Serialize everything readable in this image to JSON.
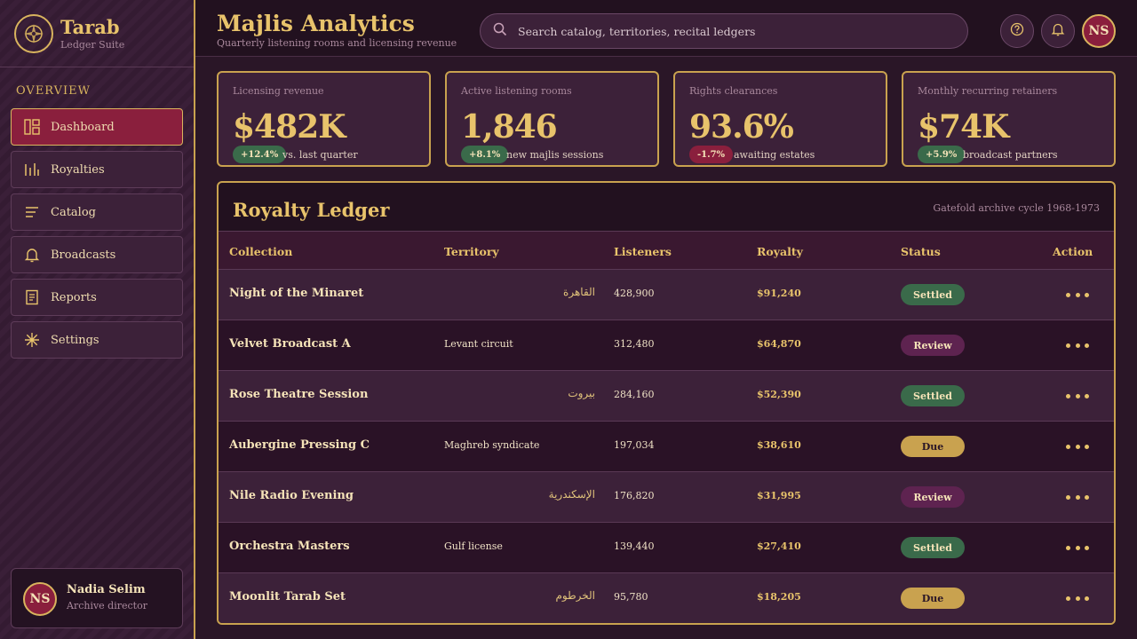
{
  "brand": {
    "name": "Tarab",
    "subtitle": "Ledger Suite"
  },
  "sidebar": {
    "heading": "OVERVIEW",
    "items": [
      {
        "label": "Dashboard",
        "icon": "dashboard-icon",
        "active": true
      },
      {
        "label": "Royalties",
        "icon": "bars-icon"
      },
      {
        "label": "Catalog",
        "icon": "list-icon"
      },
      {
        "label": "Broadcasts",
        "icon": "bell-icon"
      },
      {
        "label": "Reports",
        "icon": "document-icon"
      },
      {
        "label": "Settings",
        "icon": "sparkle-icon"
      }
    ]
  },
  "profile": {
    "initials": "NS",
    "name": "Nadia Selim",
    "role": "Archive director"
  },
  "header": {
    "title": "Majlis Analytics",
    "subtitle": "Quarterly listening rooms and licensing revenue",
    "search_placeholder": "Search catalog, territories, recital ledgers",
    "avatar_initials": "NS"
  },
  "kpis": [
    {
      "label": "Licensing revenue",
      "value": "$482K",
      "badge": "+12.4%",
      "trend": "up",
      "note": "vs. last quarter"
    },
    {
      "label": "Active listening rooms",
      "value": "1,846",
      "badge": "+8.1%",
      "trend": "up",
      "note": "new majlis sessions"
    },
    {
      "label": "Rights clearances",
      "value": "93.6%",
      "badge": "-1.7%",
      "trend": "down",
      "note": "awaiting estates"
    },
    {
      "label": "Monthly recurring retainers",
      "value": "$74K",
      "badge": "+5.9%",
      "trend": "up",
      "note": "broadcast partners"
    }
  ],
  "ledger": {
    "title": "Royalty Ledger",
    "cycle": "Gatefold archive cycle 1968-1973",
    "columns": {
      "collection": "Collection",
      "territory": "Territory",
      "listeners": "Listeners",
      "royalty": "Royalty",
      "status": "Status",
      "action": "Action"
    },
    "rows": [
      {
        "collection": "Night of the Minaret",
        "territory": "القاهرة",
        "arabic": true,
        "listeners": "428,900",
        "royalty": "$91,240",
        "status": "Settled"
      },
      {
        "collection": "Velvet Broadcast A",
        "territory": "Levant circuit",
        "arabic": false,
        "listeners": "312,480",
        "royalty": "$64,870",
        "status": "Review"
      },
      {
        "collection": "Rose Theatre Session",
        "territory": "بيروت",
        "arabic": true,
        "listeners": "284,160",
        "royalty": "$52,390",
        "status": "Settled"
      },
      {
        "collection": "Aubergine Pressing C",
        "territory": "Maghreb syndicate",
        "arabic": false,
        "listeners": "197,034",
        "royalty": "$38,610",
        "status": "Due"
      },
      {
        "collection": "Nile Radio Evening",
        "territory": "الإسكندرية",
        "arabic": true,
        "listeners": "176,820",
        "royalty": "$31,995",
        "status": "Review"
      },
      {
        "collection": "Orchestra Masters",
        "territory": "Gulf license",
        "arabic": false,
        "listeners": "139,440",
        "royalty": "$27,410",
        "status": "Settled"
      },
      {
        "collection": "Moonlit Tarab Set",
        "territory": "الخرطوم",
        "arabic": true,
        "listeners": "95,780",
        "royalty": "$18,205",
        "status": "Due"
      }
    ]
  },
  "colors": {
    "accent_gold": "#c9a24f",
    "active_crimson": "#8a1f3d",
    "settled_green": "#3a6a4a",
    "review_plum": "#5e2350"
  }
}
